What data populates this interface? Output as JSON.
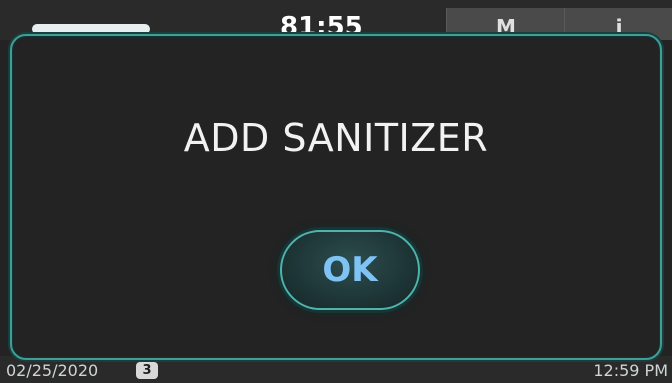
{
  "status_bar": {
    "timer": "81:55",
    "button_1_label": "M",
    "button_2_label": "i"
  },
  "footer": {
    "date": "02/25/2020",
    "badge_count": "3",
    "time": "12:59 PM"
  },
  "dialog": {
    "message": "ADD SANITIZER",
    "ok_label": "OK"
  },
  "colors": {
    "modal_border": "#3f9e98",
    "ok_text": "#7fc3f5",
    "background": "#232323"
  }
}
